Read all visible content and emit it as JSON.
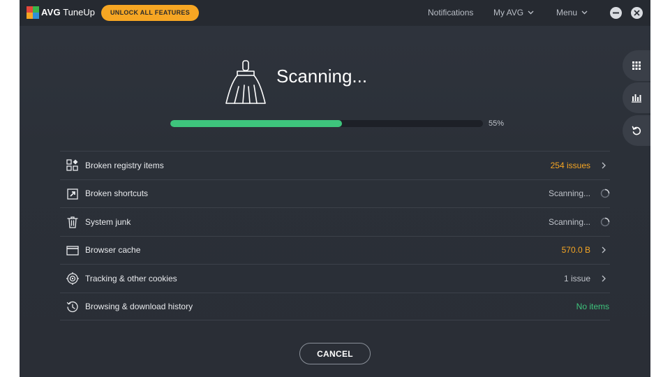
{
  "app": {
    "brand_bold": "AVG",
    "brand_light": "TuneUp",
    "unlock_label": "UNLOCK ALL FEATURES"
  },
  "nav": {
    "notifications": "Notifications",
    "my_avg": "My AVG",
    "menu": "Menu"
  },
  "scan": {
    "title": "Scanning...",
    "progress_fraction": 0.55,
    "progress_text": "55%"
  },
  "items": [
    {
      "label": "Broken registry items",
      "status": "254 issues",
      "status_color": "#f6a623",
      "icon": "registry-icon",
      "indicator": "chevron"
    },
    {
      "label": "Broken shortcuts",
      "status": "Scanning...",
      "status_color": "#c0c4cb",
      "icon": "shortcut-icon",
      "indicator": "spinner"
    },
    {
      "label": "System junk",
      "status": "Scanning...",
      "status_color": "#c0c4cb",
      "icon": "trash-icon",
      "indicator": "spinner"
    },
    {
      "label": "Browser cache",
      "status": "570.0 B",
      "status_color": "#f6a623",
      "icon": "browser-window-icon",
      "indicator": "chevron"
    },
    {
      "label": "Tracking & other cookies",
      "status": "1 issue",
      "status_color": "#c0c4cb",
      "icon": "target-icon",
      "indicator": "chevron"
    },
    {
      "label": "Browsing & download history",
      "status": "No items",
      "status_color": "#3ec47c",
      "icon": "history-clock-icon",
      "indicator": "none"
    }
  ],
  "cancel_label": "CANCEL",
  "colors": {
    "accent_orange": "#f6a623",
    "progress_green": "#3ec47c",
    "background": "#2b3038"
  }
}
